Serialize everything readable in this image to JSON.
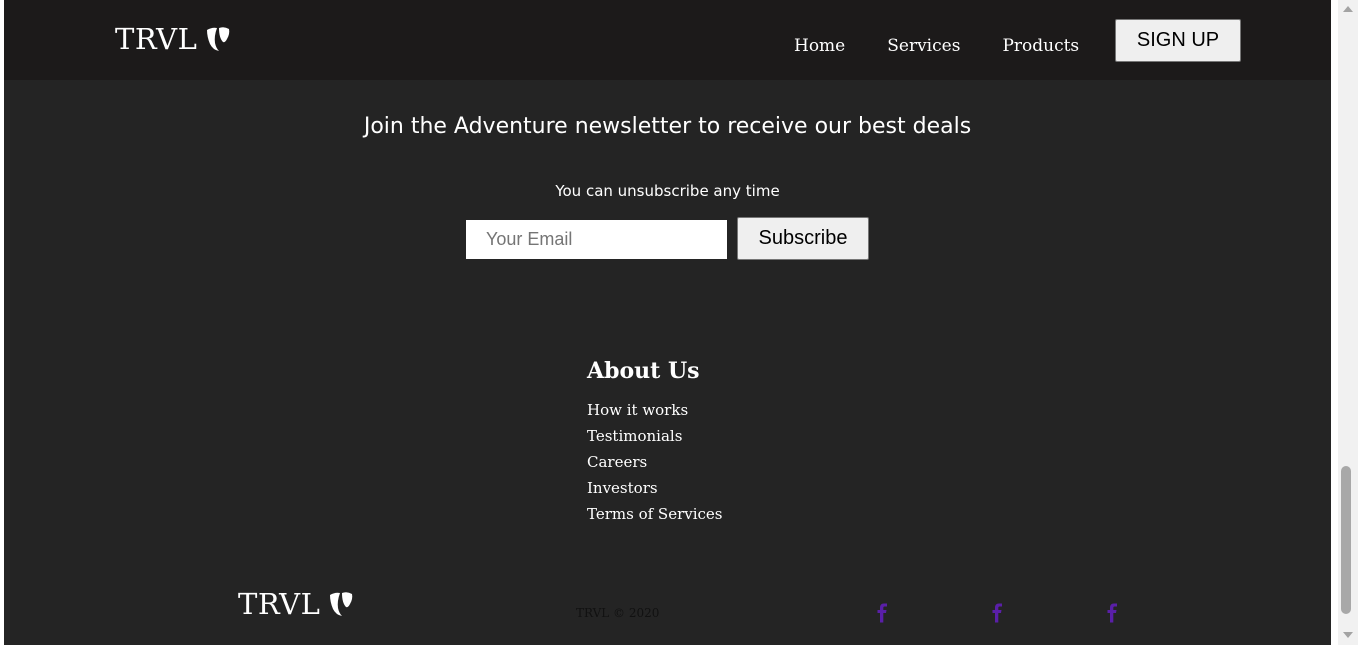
{
  "header": {
    "logo_text": "TRVL",
    "nav": [
      {
        "label": "Home"
      },
      {
        "label": "Services"
      },
      {
        "label": "Products"
      }
    ],
    "signup_label": "SIGN UP"
  },
  "newsletter": {
    "title": "Join the Adventure newsletter to receive our best deals",
    "subtitle": "You can unsubscribe any time",
    "email_placeholder": "Your Email",
    "email_value": "",
    "subscribe_label": "Subscribe"
  },
  "about": {
    "heading": "About Us",
    "links": [
      {
        "label": "How it works"
      },
      {
        "label": "Testimonials"
      },
      {
        "label": "Careers"
      },
      {
        "label": "Investors"
      },
      {
        "label": "Terms of Services"
      }
    ]
  },
  "footer": {
    "logo_text": "TRVL",
    "copyright": "TRVL © 2020",
    "social": [
      {
        "icon": "facebook-icon"
      },
      {
        "icon": "facebook-icon"
      },
      {
        "icon": "facebook-icon"
      }
    ],
    "social_color": "#5a1fa8"
  },
  "colors": {
    "page_background": "#242424",
    "navbar_background": "#1c1a1a",
    "text": "#ffffff"
  }
}
